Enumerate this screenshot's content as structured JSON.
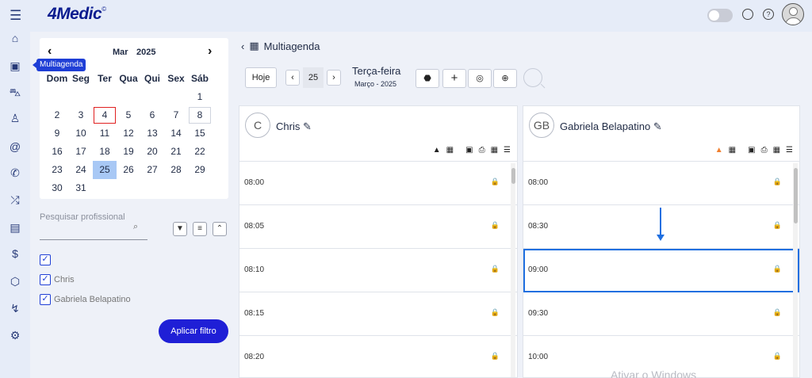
{
  "brand": {
    "logo_main": "4Medic",
    "logo_mark": "©"
  },
  "topbar_icons": {
    "chat": "chat-icon",
    "help": "?"
  },
  "sidenav": {
    "tooltip": "Multiagenda",
    "icons": [
      "home-icon",
      "calendar-icon",
      "car-icon",
      "user-icon",
      "at-icon",
      "phone-icon",
      "shuffle-icon",
      "clipboard-icon",
      "dollar-icon",
      "box-icon",
      "chart-icon",
      "settings-icon"
    ]
  },
  "calendar": {
    "month": "Mar",
    "year": "2025",
    "prev": "‹",
    "next": "›",
    "weekdays": [
      "Dom",
      "Seg",
      "Ter",
      "Qua",
      "Qui",
      "Sex",
      "Sáb"
    ],
    "days": [
      "",
      "",
      "",
      "",
      "",
      "",
      "1",
      "2",
      "3",
      "4",
      "5",
      "6",
      "7",
      "8",
      "9",
      "10",
      "11",
      "12",
      "13",
      "14",
      "15",
      "16",
      "17",
      "18",
      "19",
      "20",
      "21",
      "22",
      "23",
      "24",
      "25",
      "26",
      "27",
      "28",
      "29",
      "30",
      "31"
    ],
    "today": "4",
    "selected": "25",
    "boxed": "8"
  },
  "filter": {
    "search_placeholder": "Pesquisar profissional",
    "professionals": [
      "Chris",
      "Gabriela Belapatino"
    ],
    "apply_label": "Aplicar filtro"
  },
  "main": {
    "title": "Multiagenda",
    "today_label": "Hoje",
    "day_number": "25",
    "day_name": "Terça-feira",
    "month_year": "Março - 2025"
  },
  "columns": [
    {
      "initials": "C",
      "name": "Chris",
      "times": [
        "08:00",
        "08:05",
        "08:10",
        "08:15",
        "08:20"
      ]
    },
    {
      "initials": "GB",
      "name": "Gabriela Belapatino",
      "times": [
        "08:00",
        "08:30",
        "09:00",
        "09:30",
        "10:00"
      ]
    }
  ],
  "active_slot": {
    "column": 1,
    "time": "09:00"
  },
  "colors": {
    "brand": "#0b1c8f",
    "accent": "#1f1fd6",
    "selected_day": "#a8c8f5",
    "today_border": "#e02020",
    "warning": "#f08030"
  },
  "watermark": "Ativar o Windows"
}
